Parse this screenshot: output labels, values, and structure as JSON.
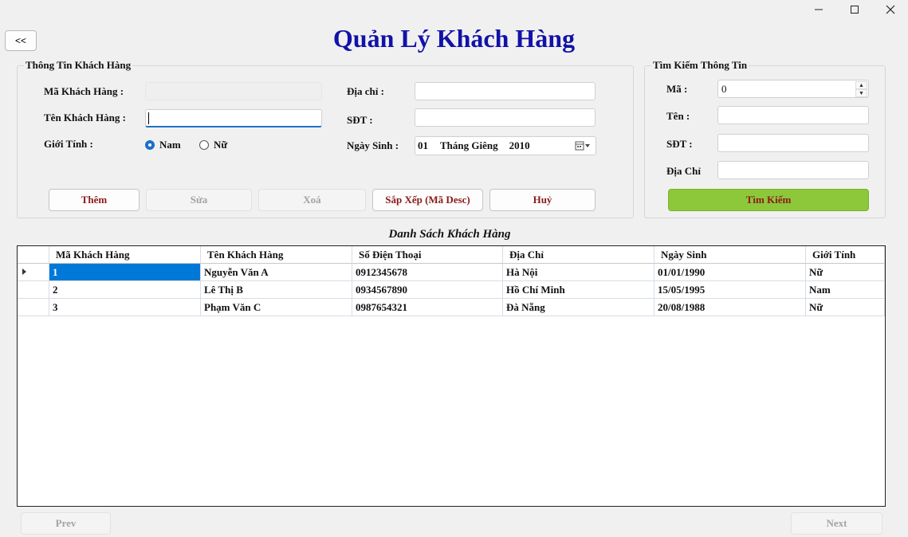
{
  "window": {
    "title": "Quản Lý Khách Hàng",
    "back_label": "<<"
  },
  "info_group": {
    "title": "Thông Tin Khách Hàng",
    "ma_label": "Mã Khách Hàng :",
    "ma_value": "",
    "ten_label": "Tên Khách Hàng :",
    "ten_value": "",
    "gioitinh_label": "Giới Tính :",
    "gender_options": [
      "Nam",
      "Nữ"
    ],
    "gender_selected": "Nam",
    "diachi_label": "Địa chỉ :",
    "diachi_value": "",
    "sdt_label": "SĐT :",
    "sdt_value": "",
    "ngaysinh_label": "Ngày Sinh :",
    "ngaysinh": {
      "day": "01",
      "month": "Tháng Giêng",
      "year": "2010"
    }
  },
  "actions": {
    "them": "Thêm",
    "sua": "Sửa",
    "xoa": "Xoá",
    "sapxep": "Sắp Xếp (Mã Desc)",
    "huy": "Huỷ"
  },
  "search_group": {
    "title": "Tìm Kiếm Thông Tin",
    "ma_label": "Mã :",
    "ma_value": "0",
    "ten_label": "Tên :",
    "sdt_label": "SĐT :",
    "diachi_label": "Địa Chỉ",
    "search_button": "Tìm Kiếm"
  },
  "list": {
    "title": "Danh Sách Khách Hàng",
    "columns": [
      "Mã Khách Hàng",
      "Tên Khách Hàng",
      "Số Điện Thoại",
      "Địa Chỉ",
      "Ngày Sinh",
      "Giới Tính"
    ],
    "rows": [
      [
        "1",
        "Nguyễn Văn A",
        "0912345678",
        "Hà Nội",
        "01/01/1990",
        "Nữ"
      ],
      [
        "2",
        "Lê Thị B",
        "0934567890",
        "Hồ Chí Minh",
        "15/05/1995",
        "Nam"
      ],
      [
        "3",
        "Phạm Văn C",
        "0987654321",
        "Đà Nẵng",
        "20/08/1988",
        "Nữ"
      ]
    ]
  },
  "pager": {
    "prev": "Prev",
    "next": "Next"
  },
  "colors": {
    "title": "#1212a8",
    "button_text": "#8b1a1a",
    "search_button": "#8dc83a",
    "selection": "#0078d7"
  }
}
